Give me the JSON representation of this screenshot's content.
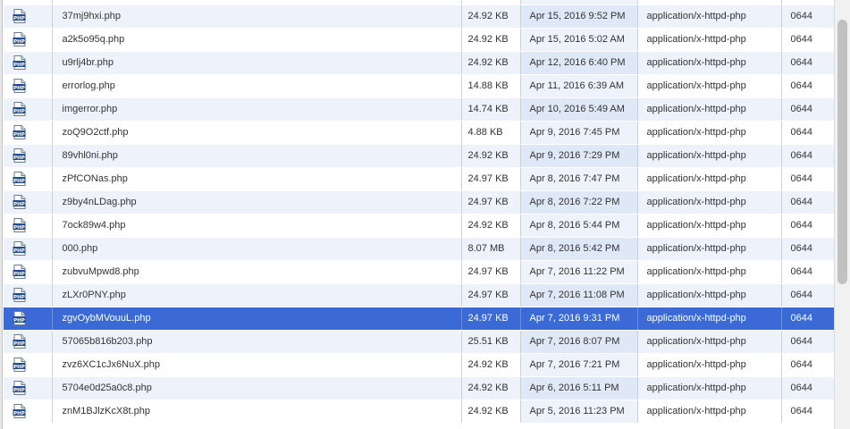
{
  "colors": {
    "row_odd": "#eef3fb",
    "row_even": "#ffffff",
    "date_col_tint": "#dfe8f6",
    "selected_row": "#3b6ad6",
    "selected_text": "#ffffff"
  },
  "icons": {
    "file_type": "php-file-icon"
  },
  "file_list": {
    "selected_index": 14,
    "rows": [
      {
        "name": "",
        "size": "",
        "date": "",
        "mime": "",
        "perm": ""
      },
      {
        "name": "37mj9hxi.php",
        "size": "24.92 KB",
        "date": "Apr 15, 2016 9:52 PM",
        "mime": "application/x-httpd-php",
        "perm": "0644"
      },
      {
        "name": "a2k5o95q.php",
        "size": "24.92 KB",
        "date": "Apr 15, 2016 5:02 AM",
        "mime": "application/x-httpd-php",
        "perm": "0644"
      },
      {
        "name": "u9rlj4br.php",
        "size": "24.92 KB",
        "date": "Apr 12, 2016 6:40 PM",
        "mime": "application/x-httpd-php",
        "perm": "0644"
      },
      {
        "name": "errorlog.php",
        "size": "14.88 KB",
        "date": "Apr 11, 2016 6:39 AM",
        "mime": "application/x-httpd-php",
        "perm": "0644"
      },
      {
        "name": "imgerror.php",
        "size": "14.74 KB",
        "date": "Apr 10, 2016 5:49 AM",
        "mime": "application/x-httpd-php",
        "perm": "0644"
      },
      {
        "name": "zoQ9O2ctf.php",
        "size": "4.88 KB",
        "date": "Apr 9, 2016 7:45 PM",
        "mime": "application/x-httpd-php",
        "perm": "0644"
      },
      {
        "name": "89vhl0ni.php",
        "size": "24.92 KB",
        "date": "Apr 9, 2016 7:29 PM",
        "mime": "application/x-httpd-php",
        "perm": "0644"
      },
      {
        "name": "zPfCONas.php",
        "size": "24.97 KB",
        "date": "Apr 8, 2016 7:47 PM",
        "mime": "application/x-httpd-php",
        "perm": "0644"
      },
      {
        "name": "z9by4nLDag.php",
        "size": "24.97 KB",
        "date": "Apr 8, 2016 7:22 PM",
        "mime": "application/x-httpd-php",
        "perm": "0644"
      },
      {
        "name": "7ock89w4.php",
        "size": "24.92 KB",
        "date": "Apr 8, 2016 5:44 PM",
        "mime": "application/x-httpd-php",
        "perm": "0644"
      },
      {
        "name": "000.php",
        "size": "8.07 MB",
        "date": "Apr 8, 2016 5:42 PM",
        "mime": "application/x-httpd-php",
        "perm": "0644"
      },
      {
        "name": "zubvuMpwd8.php",
        "size": "24.97 KB",
        "date": "Apr 7, 2016 11:22 PM",
        "mime": "application/x-httpd-php",
        "perm": "0644"
      },
      {
        "name": "zLXr0PNY.php",
        "size": "24.97 KB",
        "date": "Apr 7, 2016 11:08 PM",
        "mime": "application/x-httpd-php",
        "perm": "0644"
      },
      {
        "name": "zgvOybMVouuL.php",
        "size": "24.97 KB",
        "date": "Apr 7, 2016 9:31 PM",
        "mime": "application/x-httpd-php",
        "perm": "0644"
      },
      {
        "name": "57065b816b203.php",
        "size": "25.51 KB",
        "date": "Apr 7, 2016 8:07 PM",
        "mime": "application/x-httpd-php",
        "perm": "0644"
      },
      {
        "name": "zvz6XC1cJx6NuX.php",
        "size": "24.92 KB",
        "date": "Apr 7, 2016 7:21 PM",
        "mime": "application/x-httpd-php",
        "perm": "0644"
      },
      {
        "name": "5704e0d25a0c8.php",
        "size": "24.92 KB",
        "date": "Apr 6, 2016 5:11 PM",
        "mime": "application/x-httpd-php",
        "perm": "0644"
      },
      {
        "name": "znM1BJlzKcX8t.php",
        "size": "24.92 KB",
        "date": "Apr 5, 2016 11:23 PM",
        "mime": "application/x-httpd-php",
        "perm": "0644"
      }
    ]
  }
}
